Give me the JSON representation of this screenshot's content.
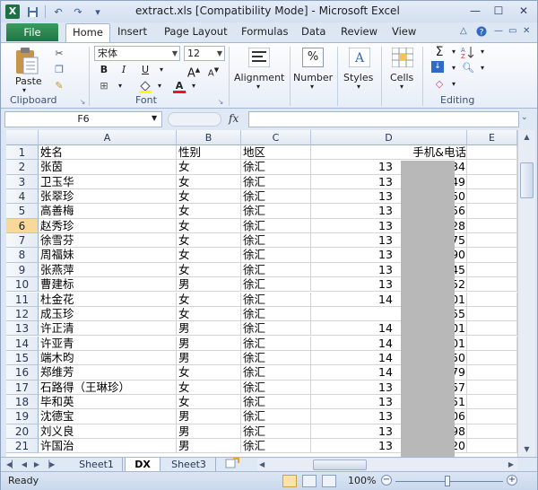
{
  "window": {
    "title": "extract.xls  [Compatibility Mode]  -  Microsoft Excel",
    "logo": "X",
    "minimize": "—",
    "maximize": "☐",
    "close": "✕"
  },
  "ribbon_tabs": [
    "File",
    "Home",
    "Insert",
    "Page Layout",
    "Formulas",
    "Data",
    "Review",
    "View"
  ],
  "ribbon": {
    "clipboard": {
      "paste_label": "Paste",
      "group_label": "Clipboard"
    },
    "font": {
      "font_name": "宋体",
      "font_size": "12",
      "group_label": "Font",
      "bold": "B",
      "italic": "I",
      "underline": "U"
    },
    "alignment": {
      "label": "Alignment"
    },
    "number": {
      "label": "Number",
      "symbol": "%"
    },
    "styles": {
      "label": "Styles"
    },
    "cells": {
      "label": "Cells"
    },
    "editing": {
      "group_label": "Editing",
      "sum_symbol": "Σ"
    }
  },
  "formula_bar": {
    "name_box": "F6",
    "fx": "fx",
    "formula": ""
  },
  "columns": [
    "A",
    "B",
    "C",
    "D",
    "E"
  ],
  "rows": [
    {
      "n": "1",
      "name": "姓名",
      "gender": "性别",
      "region": "地区",
      "phone": "手机&电话",
      "header": true
    },
    {
      "n": "2",
      "name": "张茵",
      "gender": "女",
      "region": "徐汇",
      "pre": "13",
      "suf": "34"
    },
    {
      "n": "3",
      "name": "卫玉华",
      "gender": "女",
      "region": "徐汇",
      "pre": "13",
      "suf": "49"
    },
    {
      "n": "4",
      "name": "张翠珍",
      "gender": "女",
      "region": "徐汇",
      "pre": "13",
      "suf": "50"
    },
    {
      "n": "5",
      "name": "高善梅",
      "gender": "女",
      "region": "徐汇",
      "pre": "13",
      "suf": "56"
    },
    {
      "n": "6",
      "name": "赵秀珍",
      "gender": "女",
      "region": "徐汇",
      "pre": "13",
      "suf": "28"
    },
    {
      "n": "7",
      "name": "徐雪芬",
      "gender": "女",
      "region": "徐汇",
      "pre": "13",
      "suf": "75"
    },
    {
      "n": "8",
      "name": "周福妹",
      "gender": "女",
      "region": "徐汇",
      "pre": "13",
      "suf": "90"
    },
    {
      "n": "9",
      "name": "张燕萍",
      "gender": "女",
      "region": "徐汇",
      "pre": "13",
      "suf": "45"
    },
    {
      "n": "10",
      "name": "曹建标",
      "gender": "男",
      "region": "徐汇",
      "pre": "13",
      "suf": "52"
    },
    {
      "n": "11",
      "name": "杜金花",
      "gender": "女",
      "region": "徐汇",
      "pre": "14",
      "suf": "01"
    },
    {
      "n": "12",
      "name": "成玉珍",
      "gender": "女",
      "region": "徐汇",
      "pre": "",
      "suf": "55"
    },
    {
      "n": "13",
      "name": "许正清",
      "gender": "男",
      "region": "徐汇",
      "pre": "14",
      "suf": "01"
    },
    {
      "n": "14",
      "name": "许亚青",
      "gender": "男",
      "region": "徐汇",
      "pre": "14",
      "suf": "01"
    },
    {
      "n": "15",
      "name": "端木昀",
      "gender": "男",
      "region": "徐汇",
      "pre": "14",
      "suf": "50"
    },
    {
      "n": "16",
      "name": "郑维芳",
      "gender": "女",
      "region": "徐汇",
      "pre": "14",
      "suf": "79"
    },
    {
      "n": "17",
      "name": "石路得（王琳珍）",
      "gender": "女",
      "region": "徐汇",
      "pre": "13",
      "suf": "57"
    },
    {
      "n": "18",
      "name": "毕和英",
      "gender": "女",
      "region": "徐汇",
      "pre": "13",
      "suf": "51"
    },
    {
      "n": "19",
      "name": "沈德宝",
      "gender": "男",
      "region": "徐汇",
      "pre": "13",
      "suf": "06"
    },
    {
      "n": "20",
      "name": "刘义良",
      "gender": "男",
      "region": "徐汇",
      "pre": "13",
      "suf": "98"
    },
    {
      "n": "21",
      "name": "许国治",
      "gender": "男",
      "region": "徐汇",
      "pre": "13",
      "suf": "20"
    }
  ],
  "selected_row": "6",
  "sheets": [
    "Sheet1",
    "DX",
    "Sheet3"
  ],
  "active_sheet": "DX",
  "status": {
    "ready": "Ready",
    "zoom": "100%",
    "zoom_minus": "−",
    "zoom_plus": "+"
  }
}
